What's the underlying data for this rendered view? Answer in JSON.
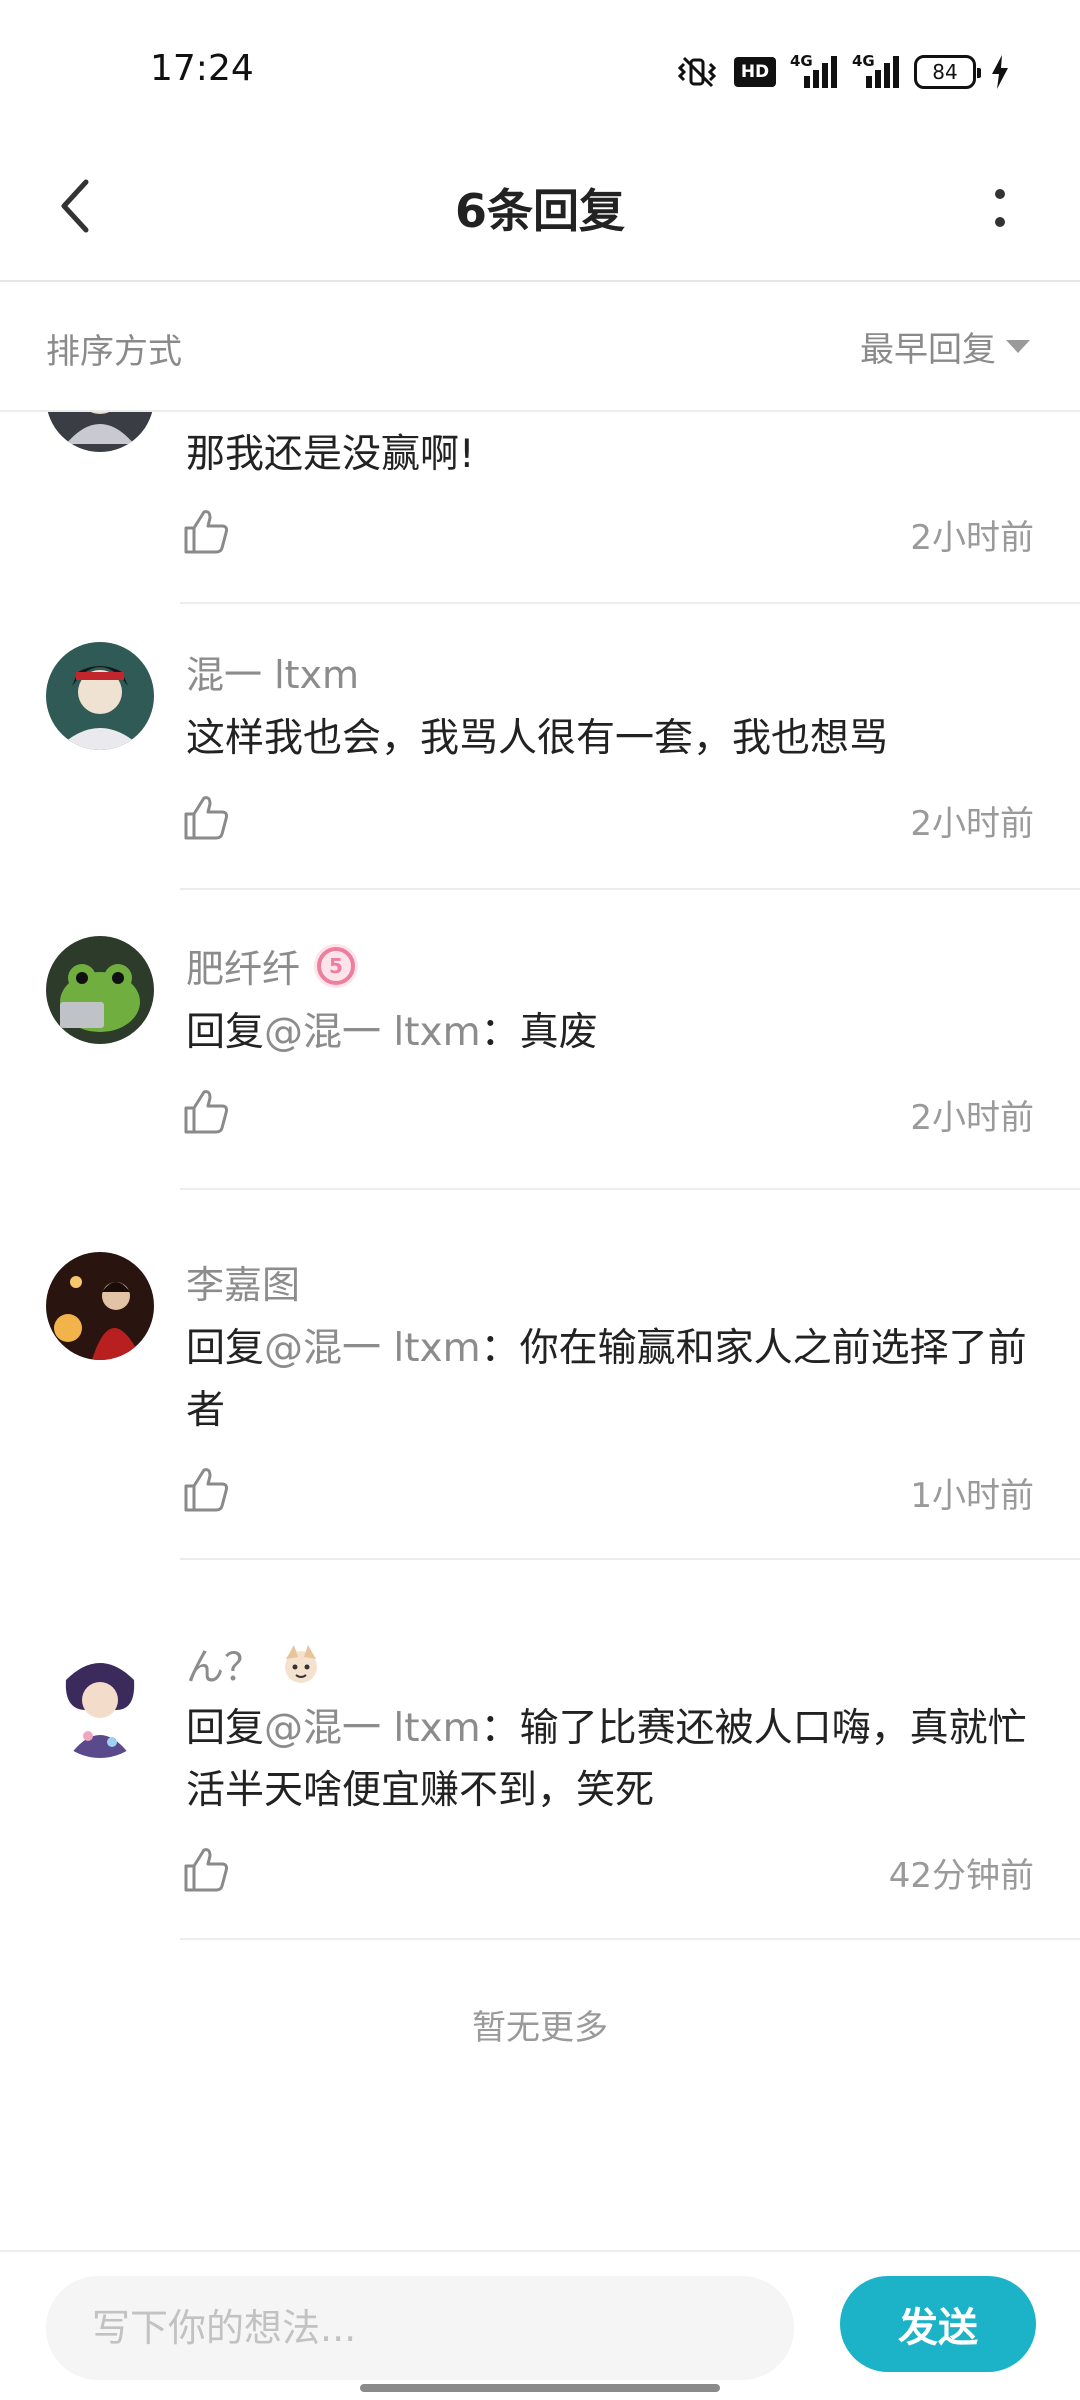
{
  "status_bar": {
    "time": "17:24",
    "battery": "84",
    "network_1": "4G",
    "network_2": "4G",
    "hd_label": "HD",
    "icons": [
      "vibrate-icon",
      "hd-icon",
      "signal-4g-icon",
      "signal-4g-icon",
      "battery-icon",
      "charging-icon"
    ]
  },
  "header": {
    "title": "6条回复",
    "back_icon": "chevron-left-icon",
    "more_icon": "more-vertical-icon"
  },
  "sort": {
    "label": "排序方式",
    "value": "最早回复",
    "caret_icon": "caret-down-icon"
  },
  "replies": [
    {
      "username": "",
      "content": "那我还是没赢啊!",
      "mention": "",
      "time": "2小时前"
    },
    {
      "username": "混一 ltxm",
      "content": "这样我也会，我骂人很有一套，我也想骂",
      "mention": "",
      "time": "2小时前"
    },
    {
      "username": "肥纤纤",
      "reply_prefix": "回复",
      "mention": "@混一 ltxm",
      "content": "：真废",
      "time": "2小时前",
      "badge": "5"
    },
    {
      "username": "李嘉图",
      "reply_prefix": "回复",
      "mention": "@混一 ltxm",
      "content": "：你在输赢和家人之前选择了前者",
      "time": "1小时前"
    },
    {
      "username": "ん？",
      "reply_prefix": "回复",
      "mention": "@混一 ltxm",
      "content": "：输了比赛还被人口嗨，真就忙活半天啥便宜赚不到，笑死",
      "time": "42分钟前"
    }
  ],
  "footer_text": "暂无更多",
  "input": {
    "placeholder": "写下你的想法...",
    "value": "",
    "send_label": "发送"
  },
  "colors": {
    "accent": "#1cb3c8",
    "muted_text": "#8c8c8c",
    "divider": "#ececec"
  }
}
